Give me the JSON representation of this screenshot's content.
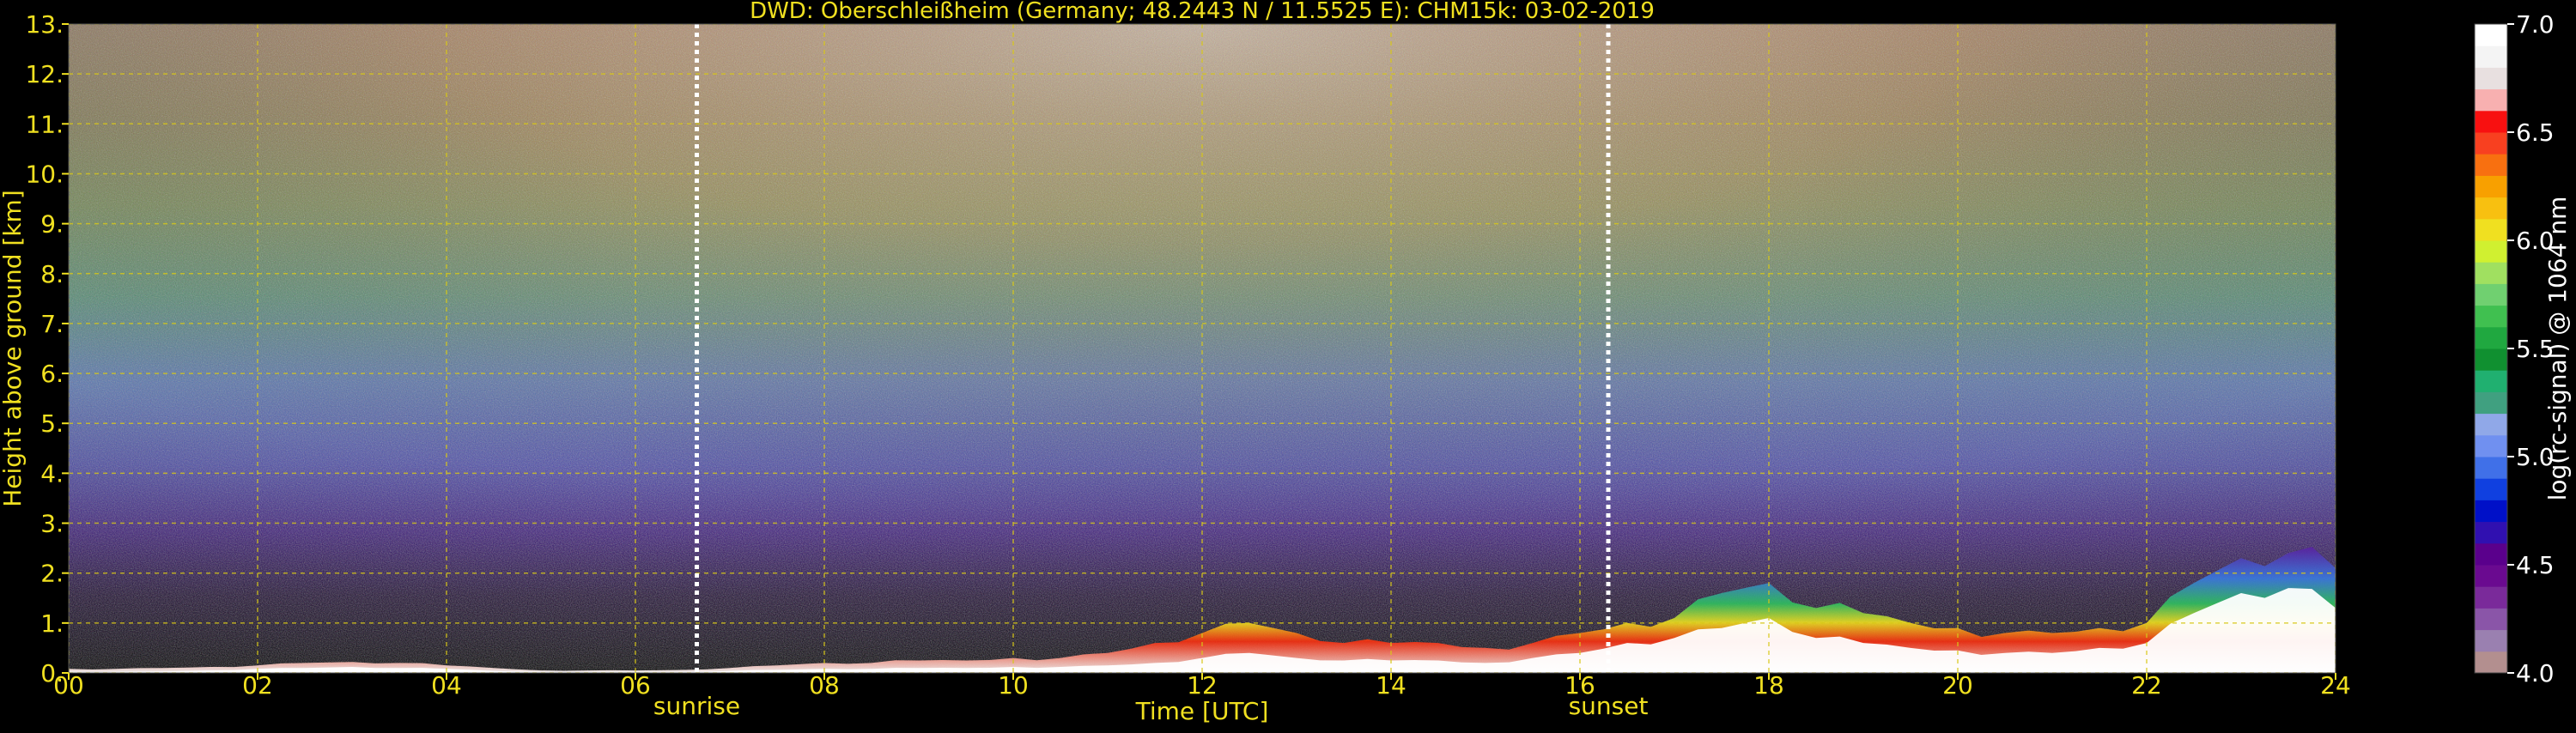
{
  "chart_data": {
    "type": "heatmap",
    "title": "DWD: Oberschleißheim (Germany; 48.2443 N / 11.5525 E):    CHM15k: 03-02-2019",
    "xlabel": "Time [UTC]",
    "ylabel": "Height above ground [km]",
    "x_range": [
      0,
      24
    ],
    "y_range": [
      0,
      13
    ],
    "x_ticks": [
      "00",
      "02",
      "04",
      "06",
      "08",
      "10",
      "12",
      "14",
      "16",
      "18",
      "20",
      "22",
      "24"
    ],
    "y_ticks": [
      "0.",
      "1.",
      "2.",
      "3.",
      "4.",
      "5.",
      "6.",
      "7.",
      "8.",
      "9.",
      "10.",
      "11.",
      "12.",
      "13."
    ],
    "grid": true,
    "markers": [
      {
        "label": "sunrise",
        "time": 6.65
      },
      {
        "label": "sunset",
        "time": 16.3
      }
    ],
    "colorbar": {
      "label": "log(rc-signal) @ 1064 nm",
      "range": [
        4.0,
        7.0
      ],
      "ticks": [
        "4.0",
        "4.5",
        "5.0",
        "5.5",
        "6.0",
        "6.5",
        "7.0"
      ],
      "colors": [
        "#b38f8f",
        "#9a80b0",
        "#8a55a8",
        "#7a2a9a",
        "#6a0a90",
        "#5a008c",
        "#3010b0",
        "#0010c8",
        "#1040e0",
        "#4070e8",
        "#7090f0",
        "#90a8e8",
        "#40a080",
        "#20b070",
        "#109030",
        "#20a840",
        "#40c050",
        "#70d070",
        "#a0e060",
        "#d0f030",
        "#f0e020",
        "#f8c010",
        "#f8a000",
        "#f87010",
        "#f84020",
        "#f81010",
        "#f8b0b0",
        "#e8e0e0",
        "#f4f4f4",
        "#ffffff"
      ]
    },
    "profile_hours": [
      0,
      0.5,
      1,
      1.5,
      2,
      2.5,
      3,
      3.5,
      4,
      4.5,
      5,
      5.5,
      6,
      6.5,
      7,
      7.5,
      8,
      8.5,
      9,
      9.5,
      10,
      10.5,
      11,
      11.5,
      12,
      12.5,
      13,
      13.5,
      14,
      14.5,
      15,
      15.5,
      16,
      16.5,
      17,
      17.5,
      18,
      18.5,
      19,
      19.5,
      20,
      20.5,
      21,
      21.5,
      22,
      22.5,
      23,
      23.5,
      24
    ],
    "boundary_layer_top_km": [
      0.08,
      0.08,
      0.1,
      0.12,
      0.15,
      0.2,
      0.22,
      0.2,
      0.15,
      0.1,
      0.05,
      0.05,
      0.05,
      0.06,
      0.1,
      0.15,
      0.2,
      0.2,
      0.25,
      0.25,
      0.3,
      0.3,
      0.4,
      0.6,
      0.8,
      1.0,
      0.8,
      0.6,
      0.6,
      0.6,
      0.5,
      0.6,
      0.8,
      1.0,
      1.1,
      1.6,
      1.8,
      1.3,
      1.2,
      1.0,
      0.9,
      0.8,
      0.8,
      0.9,
      1.0,
      1.8,
      2.3,
      2.4,
      2.1
    ],
    "strong_layer_top_km": [
      0.02,
      0.02,
      0.03,
      0.05,
      0.08,
      0.1,
      0.12,
      0.1,
      0.08,
      0.04,
      0.02,
      0.02,
      0.02,
      0.02,
      0.04,
      0.06,
      0.08,
      0.08,
      0.1,
      0.1,
      0.12,
      0.12,
      0.15,
      0.2,
      0.3,
      0.4,
      0.3,
      0.25,
      0.25,
      0.25,
      0.2,
      0.3,
      0.4,
      0.6,
      0.7,
      0.9,
      1.1,
      0.7,
      0.6,
      0.5,
      0.45,
      0.4,
      0.4,
      0.5,
      0.6,
      1.2,
      1.6,
      1.7,
      1.3
    ]
  }
}
